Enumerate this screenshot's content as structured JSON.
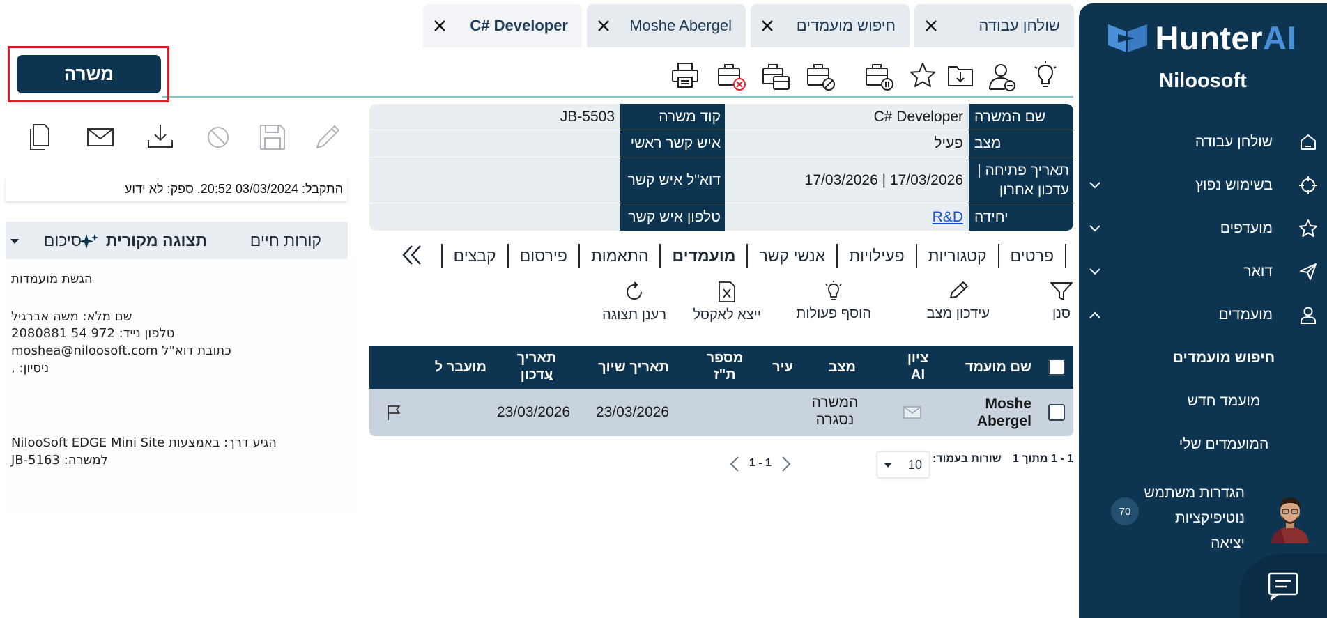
{
  "sidebar": {
    "logo": {
      "hunter": "Hunter",
      "ai": "AI"
    },
    "org_name": "Niloosoft",
    "items": [
      {
        "label": "שולחן עבודה",
        "icon": "home-icon"
      },
      {
        "label": "בשימוש נפוץ",
        "icon": "crosshair-icon"
      },
      {
        "label": "מועדפים",
        "icon": "star-icon"
      },
      {
        "label": "דואר",
        "icon": "send-icon"
      },
      {
        "label": "מועמדים",
        "icon": "person-icon"
      }
    ],
    "subitems": [
      "חיפוש מועמדים",
      "מועמד חדש",
      "המועמדים שלי"
    ],
    "user_links": [
      "הגדרות משתמש",
      "נוטיפיקציות",
      "יציאה"
    ],
    "notification_count": "70"
  },
  "tabs": [
    {
      "label": "שולחן עבודה"
    },
    {
      "label": "חיפוש מועמדים"
    },
    {
      "label": "Moshe Abergel"
    },
    {
      "label": "C# Developer"
    }
  ],
  "job_button": "משרה",
  "details": {
    "rows": [
      {
        "label1": "שם המשרה",
        "value1": "C# Developer",
        "label2": "קוד משרה",
        "value2": "JB-5503"
      },
      {
        "label1": "מצב",
        "value1": "פעיל",
        "label2": "איש קשר ראשי",
        "value2": ""
      },
      {
        "label1": "תאריך פתיחה | עדכון אחרון",
        "value1": "17/03/2026 | 17/03/2026",
        "label2": "דוא\"ל איש קשר",
        "value2": ""
      },
      {
        "label1": "יחידה",
        "value1": "R&D",
        "label2": "טלפון איש קשר",
        "value2": ""
      }
    ]
  },
  "subtabs": [
    "פרטים",
    "קטגוריות",
    "פעילויות",
    "אנשי קשר",
    "מועמדים",
    "התאמות",
    "פירסום",
    "קבצים"
  ],
  "actions": {
    "filter": "סנן",
    "edit_status": "עידכון מצב",
    "add_activities": "הוסף פעולות",
    "export_excel": "ייצא לאקסל",
    "refresh": "רענן תצוגה"
  },
  "table": {
    "headers": {
      "name": "שם מועמד",
      "ai_score": "ציון AI",
      "status": "מצב",
      "city": "עיר",
      "id_number": "מספר ת\"ז",
      "assign_date": "תאריך שיוך",
      "update_date": "תאריך עדכון",
      "moved_to": "מועבר ל"
    },
    "rows": [
      {
        "name": "Moshe Abergel",
        "status": "המשרה נסגרה",
        "assign_date": "23/03/2026",
        "update_date": "23/03/2026"
      }
    ]
  },
  "pager": {
    "range": "1 - 1 מתוך 1",
    "rows_label": "שורות בעמוד:",
    "rows_value": "10",
    "page": "1 - 1"
  },
  "left_panel": {
    "received": "התקבל: 03/03/2024 20:52. ספק: לא ידוע",
    "cv_tabs": {
      "cv": "קורות חיים",
      "original": "תצוגה מקורית",
      "summary": "סיכום"
    },
    "cv_lines": [
      "הגשת מועמדות",
      "שם מלא: משה אברגיל",
      "טלפון נייד: 972 54 2080881",
      "כתובת  דוא\"ל moshea@niloosoft.com",
      "ניסיון:   ,",
      "הגיע דרך:   באמצעות  NilooSoft EDGE Mini Site",
      "למשרה: JB-5163"
    ]
  },
  "colors": {
    "sidebar": "#0d3552",
    "accent_blue": "#4a90d9",
    "highlight_frame": "#e0202a",
    "row_bg": "#c8d3dd"
  }
}
